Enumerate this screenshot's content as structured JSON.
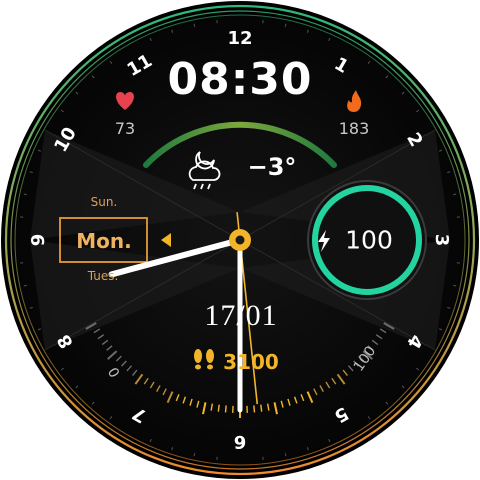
{
  "time": "08:30",
  "heart_rate": "73",
  "calories": "183",
  "weather": {
    "temperature": "−3°",
    "icon": "cloud-moon-rain-icon"
  },
  "day_picker": {
    "previous": "Sun.",
    "current": "Mon.",
    "next": "Tues."
  },
  "battery": {
    "level": "100",
    "fraction": 1.0
  },
  "date": "17/01",
  "steps": {
    "count": "3100",
    "scale_min": "0",
    "scale_max": "100"
  },
  "dial_numbers": [
    "12",
    "1",
    "2",
    "3",
    "4",
    "5",
    "6",
    "7",
    "8",
    "9",
    "10",
    "11"
  ],
  "hands": {
    "hour": 8,
    "minute": 30,
    "second": 29
  },
  "colors": {
    "accent": "#f2b52a",
    "heart": "#e8424f",
    "calorie": "#f26a1b",
    "battery_ring": "#23d3a0",
    "day_box": "#e99a3b"
  }
}
